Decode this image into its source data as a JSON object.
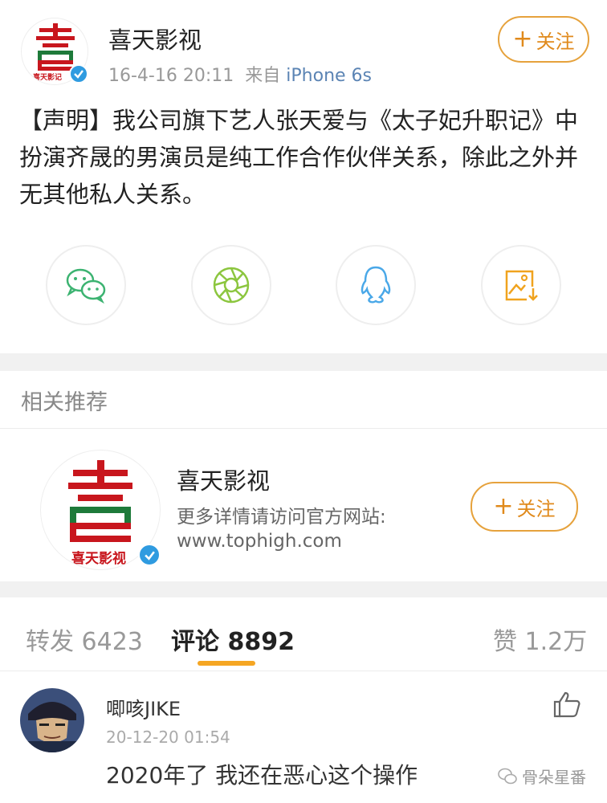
{
  "post": {
    "author": "喜天影视",
    "date": "16-4-16 20:11",
    "source_prefix": "来自",
    "source_device": "iPhone 6s",
    "follow_label": "关注",
    "text": "【声明】我公司旗下艺人张天爱与《太子妃升职记》中扮演齐晟的男演员是纯工作合作伙伴关系，除此之外并无其他私人关系。",
    "logo_caption": "喜天影记"
  },
  "share_icons": [
    "wechat-icon",
    "moments-icon",
    "qq-icon",
    "save-image-icon"
  ],
  "related": {
    "section_title": "相关推荐",
    "name": "喜天影视",
    "desc_line1": "更多详情请访问官方网站:",
    "desc_line2": "www.tophigh.com",
    "follow_label": "关注",
    "logo_caption": "喜天影视"
  },
  "tabs": {
    "repost": "转发 6423",
    "comments": "评论 8892",
    "likes": "赞 1.2万"
  },
  "comment": {
    "username": "唧咳JIKE",
    "time": "20-12-20 01:54",
    "text": "2020年了 我还在恶心这个操作"
  },
  "watermark": "骨朵星番",
  "colors": {
    "accent": "#e08a1c",
    "brand_red": "#c8161d",
    "brand_green": "#1e7a3a",
    "verified_blue": "#2f9be0"
  }
}
